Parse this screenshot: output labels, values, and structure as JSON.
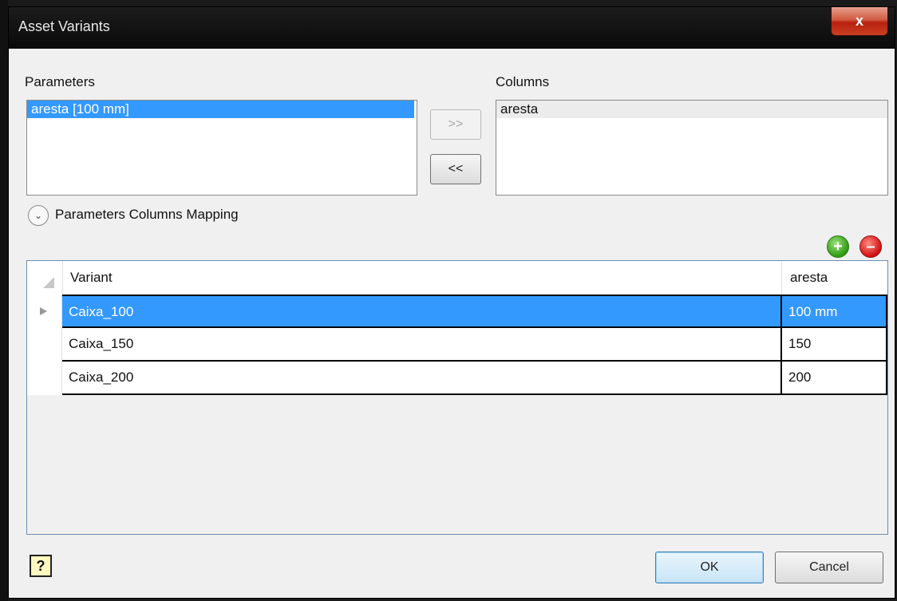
{
  "window": {
    "title": "Asset Variants",
    "close_label": "x"
  },
  "parameters": {
    "label": "Parameters",
    "items": [
      "aresta [100 mm]"
    ]
  },
  "columns": {
    "label": "Columns",
    "items": [
      "aresta"
    ]
  },
  "move_buttons": {
    "add": ">>",
    "remove": "<<"
  },
  "mapping": {
    "label": "Parameters Columns Mapping"
  },
  "grid": {
    "headers": [
      "Variant",
      "aresta"
    ],
    "rows": [
      {
        "variant": "Caixa_100",
        "aresta": "100 mm",
        "selected": true
      },
      {
        "variant": "Caixa_150",
        "aresta": "150",
        "selected": false
      },
      {
        "variant": "Caixa_200",
        "aresta": "200",
        "selected": false
      }
    ]
  },
  "footer": {
    "help_label": "?",
    "ok_label": "OK",
    "cancel_label": "Cancel"
  }
}
